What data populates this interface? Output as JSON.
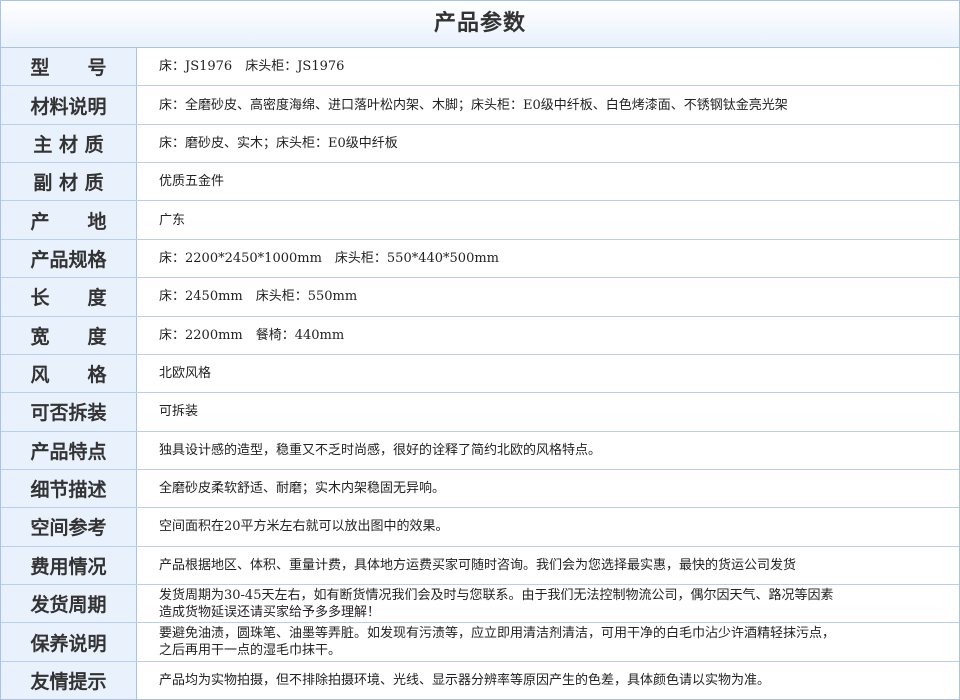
{
  "title": "产品参数",
  "rows": [
    {
      "label": "型　　号",
      "value": "床：JS1976　床头柜：JS1976"
    },
    {
      "label": "材料说明",
      "value": "床：全磨砂皮、高密度海绵、进口落叶松内架、木脚；床头柜：E0级中纤板、白色烤漆面、不锈钢钛金亮光架"
    },
    {
      "label": "主 材 质",
      "value": "床：磨砂皮、实木；床头柜：E0级中纤板"
    },
    {
      "label": "副 材 质",
      "value": "优质五金件"
    },
    {
      "label": "产　　地",
      "value": "广东"
    },
    {
      "label": "产品规格",
      "value": "床：2200*2450*1000mm　床头柜：550*440*500mm"
    },
    {
      "label": "长　　度",
      "value": "床：2450mm　床头柜：550mm"
    },
    {
      "label": "宽　　度",
      "value": "床：2200mm　餐椅：440mm"
    },
    {
      "label": "风　　格",
      "value": "北欧风格"
    },
    {
      "label": "可否拆装",
      "value": "可拆装"
    },
    {
      "label": "产品特点",
      "value": "独具设计感的造型，稳重又不乏时尚感，很好的诠释了简约北欧的风格特点。"
    },
    {
      "label": "细节描述",
      "value": "全磨砂皮柔软舒适、耐磨；实木内架稳固无异响。"
    },
    {
      "label": "空间参考",
      "value": "空间面积在20平方米左右就可以放出图中的效果。"
    },
    {
      "label": "费用情况",
      "value": "产品根据地区、体积、重量计费，具体地方运费买家可随时咨询。我们会为您选择最实惠，最快的货运公司发货"
    },
    {
      "label": "发货周期",
      "value": "发货周期为30-45天左右，如有断货情况我们会及时与您联系。由于我们无法控制物流公司，偶尔因天气、路况等因素\n造成货物延误还请买家给予多多理解！"
    },
    {
      "label": "保养说明",
      "value": "要避免油渍，圆珠笔、油墨等弄脏。如发现有污渍等，应立即用清洁剂清洁，可用干净的白毛巾沾少许酒精轻抹污点，\n之后再用干一点的湿毛巾抹干。"
    },
    {
      "label": "友情提示",
      "value": "产品均为实物拍摄，但不排除拍摄环境、光线、显示器分辨率等原因产生的色差，具体颜色请以实物为准。"
    }
  ]
}
